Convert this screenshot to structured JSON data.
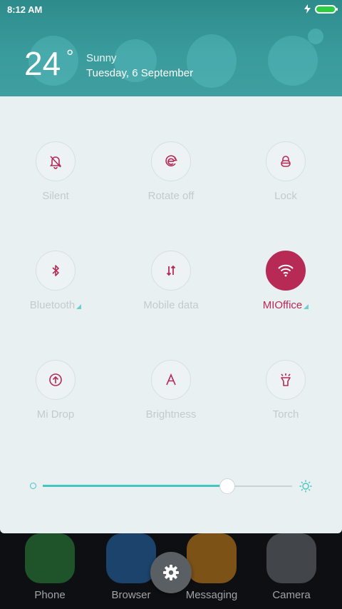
{
  "status_bar": {
    "time": "8:12 AM",
    "icons": [
      "charging-icon",
      "battery-icon"
    ],
    "battery_color": "#2ecc40"
  },
  "weather": {
    "temperature": "24",
    "degree_symbol": "°",
    "condition": "Sunny",
    "date": "Tuesday, 6 September"
  },
  "toggles": [
    {
      "label": "Silent",
      "icon": "silent-bell-icon",
      "active": false
    },
    {
      "label": "Rotate off",
      "icon": "rotate-lock-icon",
      "active": false
    },
    {
      "label": "Lock",
      "icon": "lock-icon",
      "active": false
    },
    {
      "label": "Bluetooth",
      "icon": "bluetooth-icon",
      "active": false,
      "has_menu": true
    },
    {
      "label": "Mobile data",
      "icon": "mobile-data-icon",
      "active": false
    },
    {
      "label": "MIOffice",
      "icon": "wifi-icon",
      "active": true,
      "has_menu": true
    },
    {
      "label": "Mi Drop",
      "icon": "mi-drop-icon",
      "active": false
    },
    {
      "label": "Brightness",
      "icon": "brightness-auto-icon",
      "active": false
    },
    {
      "label": "Torch",
      "icon": "torch-icon",
      "active": false
    }
  ],
  "brightness_slider": {
    "value_fraction": 0.74
  },
  "dock": {
    "apps": [
      {
        "label": "Phone",
        "icon": "phone-icon"
      },
      {
        "label": "Browser",
        "icon": "browser-icon"
      },
      {
        "label": "Messaging",
        "icon": "messaging-icon"
      },
      {
        "label": "Camera",
        "icon": "camera-icon"
      }
    ]
  },
  "colors": {
    "accent": "#b62a55",
    "teal": "#46c4c4",
    "panel_bg": "#e9f0f1"
  }
}
